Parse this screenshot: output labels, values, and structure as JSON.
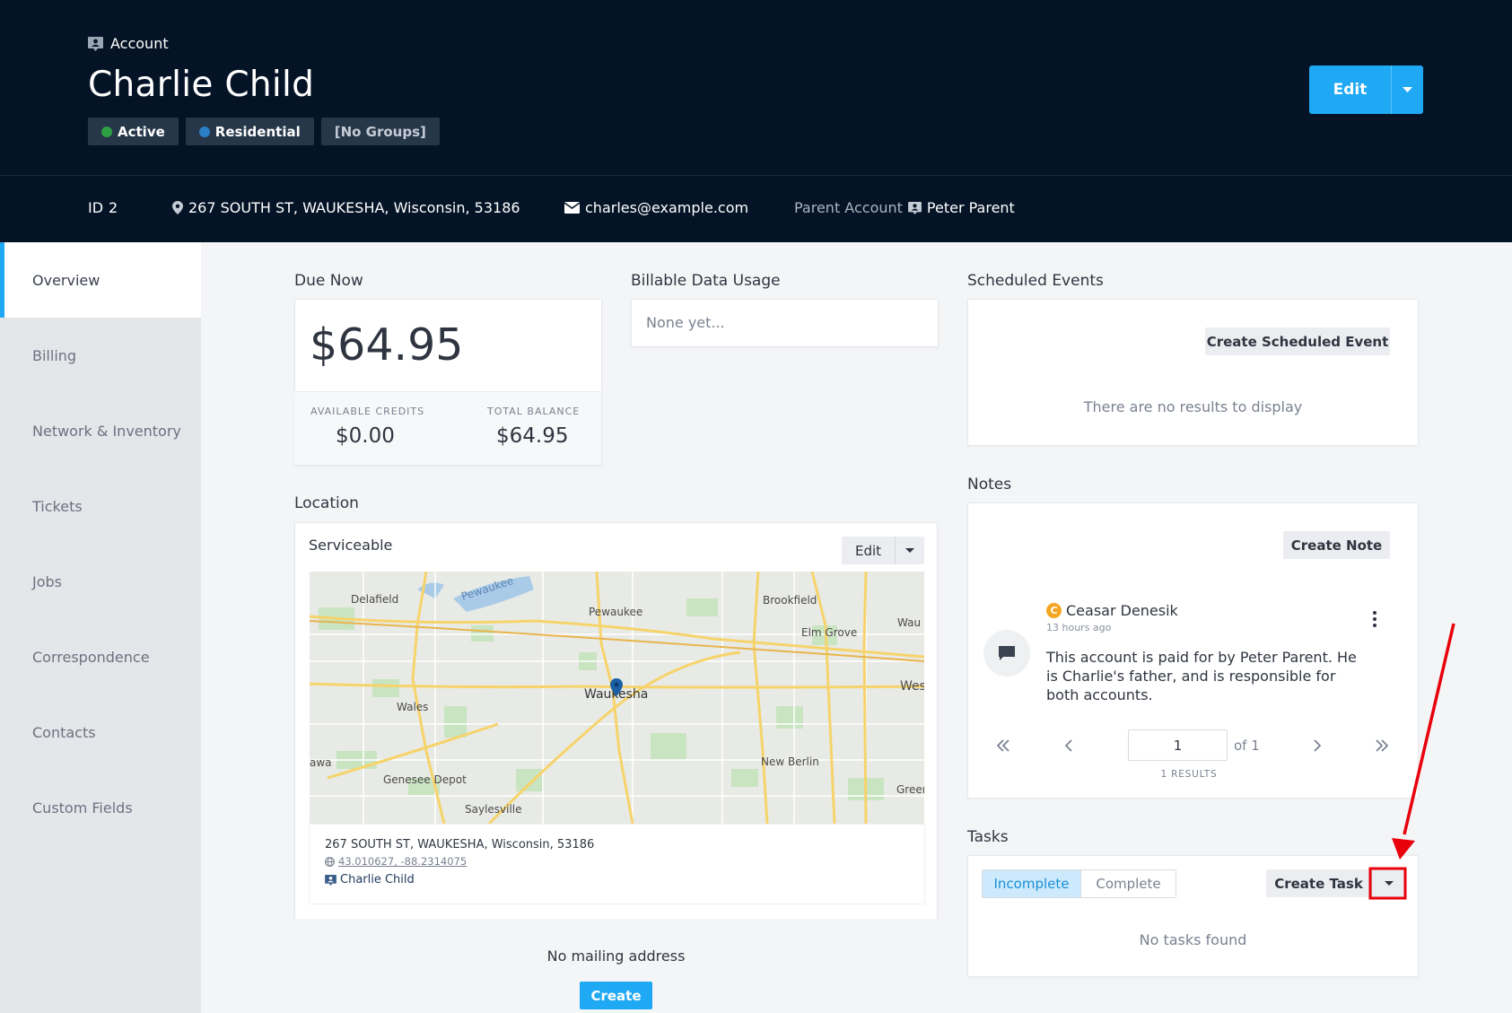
{
  "header": {
    "breadcrumb": "Account",
    "title": "Charlie Child",
    "badges": [
      {
        "label": "Active",
        "dot_color": "#2ea043"
      },
      {
        "label": "Residential",
        "dot_color": "#2b7fc6"
      },
      {
        "label": "[No Groups]"
      }
    ],
    "edit_label": "Edit"
  },
  "info_bar": {
    "id_label": "ID",
    "id_value": "2",
    "address": "267 SOUTH ST, WAUKESHA, Wisconsin, 53186",
    "email": "charles@example.com",
    "parent_label": "Parent Account",
    "parent_name": "Peter Parent"
  },
  "sidebar": {
    "items": [
      {
        "label": "Overview",
        "active": true
      },
      {
        "label": "Billing"
      },
      {
        "label": "Network & Inventory"
      },
      {
        "label": "Tickets"
      },
      {
        "label": "Jobs"
      },
      {
        "label": "Correspondence"
      },
      {
        "label": "Contacts"
      },
      {
        "label": "Custom Fields"
      }
    ]
  },
  "due_now": {
    "title": "Due Now",
    "amount": "$64.95",
    "available_credits_label": "AVAILABLE CREDITS",
    "available_credits": "$0.00",
    "total_balance_label": "TOTAL BALANCE",
    "total_balance": "$64.95"
  },
  "data_usage": {
    "title": "Billable Data Usage",
    "empty": "None yet..."
  },
  "location": {
    "title": "Location",
    "status": "Serviceable",
    "edit_label": "Edit",
    "address": "267 SOUTH ST, WAUKESHA, Wisconsin, 53186",
    "coordinates": "43.010627, -88.2314075",
    "account_name": "Charlie Child",
    "map_labels": [
      "Delafield",
      "Pewaukee",
      "Pewaukee",
      "Brookfield",
      "Elm Grove",
      "Waukesha",
      "Wales",
      "Genesee Depot",
      "Saylesville",
      "New Berlin",
      "Wau",
      "Wes",
      "Greer",
      "awa"
    ],
    "mailing_empty": "No mailing address",
    "create_label": "Create"
  },
  "scheduled_events": {
    "title": "Scheduled Events",
    "create_label": "Create Scheduled Event",
    "empty": "There are no results to display"
  },
  "notes": {
    "title": "Notes",
    "create_label": "Create Note",
    "author_initial": "C",
    "author": "Ceasar Denesik",
    "time": "13 hours ago",
    "body": "This account is paid for by Peter Parent. He is Charlie's father, and is responsible for both accounts.",
    "page": "1",
    "of_label": "of 1",
    "results": "1 RESULTS"
  },
  "tasks": {
    "title": "Tasks",
    "tab_incomplete": "Incomplete",
    "tab_complete": "Complete",
    "create_label": "Create Task",
    "empty": "No tasks found"
  },
  "colors": {
    "header_bg": "#041426",
    "accent": "#1fa9f5",
    "annotation_red": "#e8000b"
  }
}
